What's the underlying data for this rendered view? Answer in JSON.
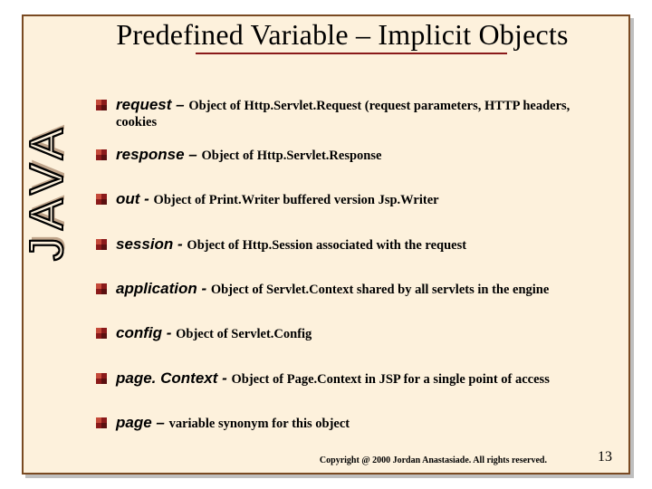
{
  "title": "Predefined Variable – Implicit Objects",
  "sidebar_label": "JAVA",
  "items": [
    {
      "term": "request – ",
      "desc": "Object of Http.Servlet.Request (request parameters, HTTP headers, cookies"
    },
    {
      "term": "response – ",
      "desc": "Object of Http.Servlet.Response"
    },
    {
      "term": "out - ",
      "desc": "Object of Print.Writer buffered version Jsp.Writer"
    },
    {
      "term": "session - ",
      "desc": "Object of Http.Session associated with the request"
    },
    {
      "term": "application - ",
      "desc": "Object of Servlet.Context shared by all servlets in the engine"
    },
    {
      "term": "config - ",
      "desc": "Object of Servlet.Config"
    },
    {
      "term": "page. Context - ",
      "desc": "Object of Page.Context in JSP for a single point of access"
    },
    {
      "term": "page – ",
      "desc": "variable synonym for this object"
    }
  ],
  "copyright": "Copyright @ 2000 Jordan Anastasiade.  All rights reserved.",
  "page_number": "13"
}
